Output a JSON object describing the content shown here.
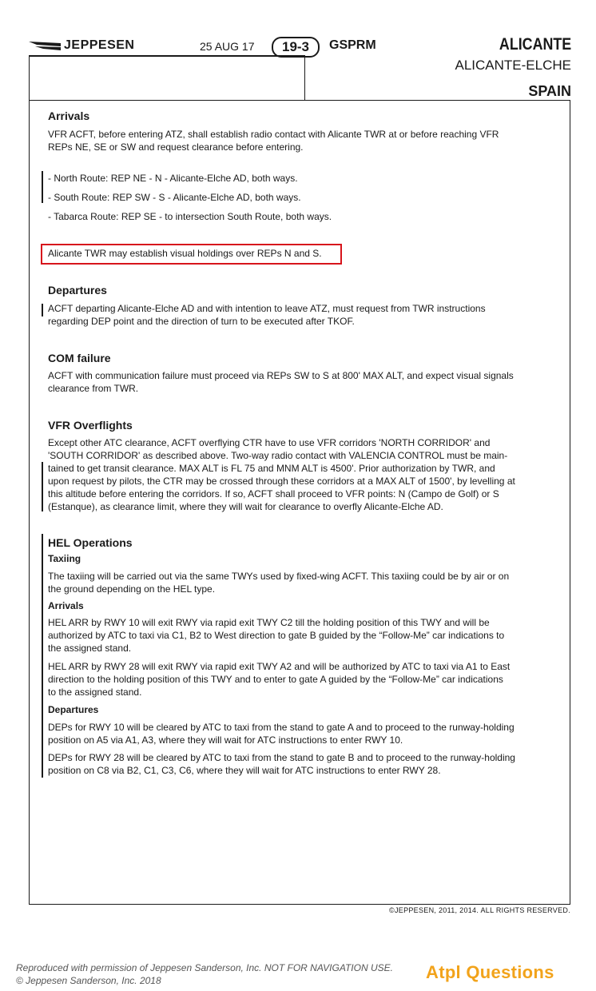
{
  "header": {
    "logo_text": "JEPPESEN",
    "date": "25 AUG 17",
    "chart_number": "19-3",
    "chart_code": "GSPRM",
    "city": "ALICANTE",
    "airport": "ALICANTE-ELCHE",
    "country": "SPAIN"
  },
  "arrivals": {
    "heading": "Arrivals",
    "intro_1": "VFR ACFT, before entering ATZ, shall establish radio contact with Alicante TWR at or before reaching VFR",
    "intro_2": "REPs NE, SE or SW and request clearance before entering.",
    "routes": [
      "- North Route: REP NE - N - Alicante-Elche AD, both ways.",
      "- South Route: REP SW - S - Alicante-Elche AD, both ways.",
      "- Tabarca Route: REP SE - to intersection South Route, both ways."
    ],
    "holding_note": "Alicante TWR may establish visual holdings over REPs N and S."
  },
  "departures": {
    "heading": "Departures",
    "lines": [
      "ACFT departing Alicante-Elche AD and with intention to leave ATZ, must request from TWR instructions",
      "regarding DEP point and the direction of turn to be executed after TKOF."
    ]
  },
  "com_failure": {
    "heading": "COM failure",
    "lines": [
      "ACFT with communication failure must proceed via REPs SW to S at 800' MAX ALT, and expect visual signals",
      "clearance from TWR."
    ]
  },
  "vfr_overflights": {
    "heading": "VFR Overflights",
    "lines": [
      "Except other ATC clearance, ACFT overflying CTR have to use VFR corridors 'NORTH CORRIDOR' and",
      "'SOUTH CORRIDOR' as described above. Two-way radio contact with VALENCIA CONTROL must be main-",
      "tained to get transit clearance. MAX ALT is FL 75 and MNM ALT is 4500'.  Prior authorization by TWR, and",
      "upon request by pilots, the CTR may be crossed through these corridors at a MAX ALT of 1500', by levelling at",
      "this altitude before entering the corridors. If so, ACFT shall proceed to VFR points: N (Campo de Golf) or S",
      "(Estanque), as clearance limit, where they will wait for clearance to overfly Alicante-Elche AD."
    ]
  },
  "hel_operations": {
    "heading": "HEL Operations",
    "taxiing_heading": "Taxiing",
    "taxiing_lines": [
      "The taxiing will be carried out via the same TWYs used by fixed-wing ACFT. This taxiing could be by air or on",
      "the ground depending on the HEL type."
    ],
    "arrivals_heading": "Arrivals",
    "arr10_lines": [
      "HEL ARR by RWY 10 will exit RWY via rapid exit TWY C2 till the holding position of this TWY and will be",
      "authorized by ATC to taxi via C1, B2 to West direction to gate B guided by the “Follow-Me” car indications to",
      "the assigned stand."
    ],
    "arr28_lines": [
      "HEL ARR by RWY 28 will exit RWY via rapid exit TWY A2 and will be authorized by ATC to taxi via A1 to East",
      "direction to the holding position of this TWY and to enter to gate A guided by the “Follow-Me” car indications",
      "to the assigned stand."
    ],
    "departures_heading": "Departures",
    "dep10_lines": [
      "DEPs for RWY 10 will be cleared by ATC to taxi from the stand to gate A and to proceed to the runway-holding",
      "position on A5 via A1, A3, where they will wait for ATC instructions to enter RWY 10."
    ],
    "dep28_lines": [
      "DEPs for RWY 28 will be cleared by ATC to taxi from the stand to gate B and to proceed to the runway-holding",
      "position on C8 via B2, C1, C3, C6, where they will wait for ATC instructions to enter RWY 28."
    ]
  },
  "copyright": "©JEPPESEN, 2011, 2014. ALL RIGHTS RESERVED.",
  "footer": {
    "line_1": "Reproduced with permission of Jeppesen Sanderson, Inc. NOT FOR NAVIGATION USE.",
    "line_2": "© Jeppesen Sanderson, Inc. 2018",
    "brand": "Atpl Questions"
  },
  "colors": {
    "highlight_border": "#d7141c",
    "brand": "#f2a31b"
  }
}
